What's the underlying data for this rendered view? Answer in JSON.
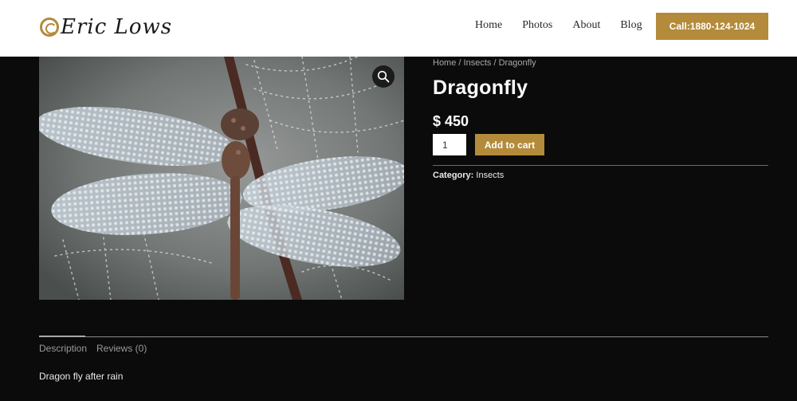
{
  "header": {
    "logo_text": "Eric Lows",
    "nav": [
      "Home",
      "Photos",
      "About",
      "Blog"
    ],
    "call_label": "Call:1880-124-1024",
    "accent_color": "#b38b3b"
  },
  "product": {
    "breadcrumb": [
      "Home",
      "Insects",
      "Dragonfly"
    ],
    "breadcrumb_sep": "/",
    "title": "Dragonfly",
    "price": "$ 450",
    "quantity": "1",
    "add_to_cart_label": "Add to cart",
    "category_label": "Category:",
    "category_value": "Insects",
    "image_icon": "zoom-icon"
  },
  "tabs": {
    "items": [
      "Description",
      "Reviews (0)"
    ],
    "active": "Description"
  },
  "description": {
    "text": "Dragon fly after rain"
  }
}
